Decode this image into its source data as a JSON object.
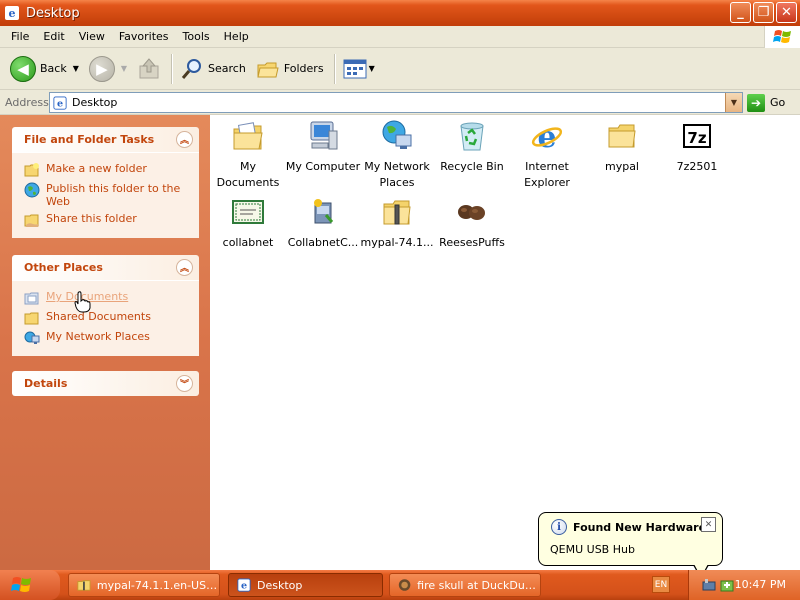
{
  "window": {
    "title": "Desktop"
  },
  "menu": [
    "File",
    "Edit",
    "View",
    "Favorites",
    "Tools",
    "Help"
  ],
  "toolbar": {
    "back": "Back",
    "search": "Search",
    "folders": "Folders"
  },
  "address": {
    "label": "Address",
    "value": "Desktop",
    "go": "Go"
  },
  "panels": {
    "file_tasks": {
      "title": "File and Folder Tasks",
      "items": [
        "Make a new folder",
        "Publish this folder to the Web",
        "Share this folder"
      ]
    },
    "other_places": {
      "title": "Other Places",
      "items": [
        "My Documents",
        "Shared Documents",
        "My Network Places"
      ]
    },
    "details": {
      "title": "Details"
    }
  },
  "icons": [
    "My Documents",
    "My Computer",
    "My Network Places",
    "Recycle Bin",
    "Internet Explorer",
    "mypal",
    "7z2501",
    "collabnet",
    "CollabnetC...",
    "mypal-74.1...",
    "ReesesPuffs"
  ],
  "balloon": {
    "title": "Found New Hardware",
    "message": "QEMU USB Hub"
  },
  "taskbar": {
    "buttons": [
      "mypal-74.1.1.en-US....",
      "Desktop",
      "fire skull at DuckDuck..."
    ],
    "lang": "EN",
    "clock": "10:47 PM"
  },
  "colors": {
    "accent": "#c2460d",
    "titlebar": "#d14a11",
    "pane": "#d9744a"
  }
}
